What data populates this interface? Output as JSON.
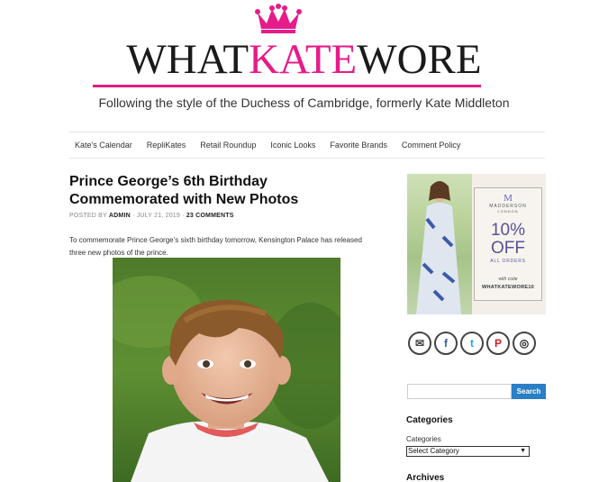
{
  "site": {
    "logo_part1": "WHAT",
    "logo_part2": "KATE",
    "logo_part3": "WORE",
    "tagline": "Following the style of the Duchess of Cambridge, formerly Kate Middleton",
    "accent_color": "#e51c8a"
  },
  "nav": {
    "items": [
      {
        "label": "Kate's Calendar"
      },
      {
        "label": "RepliKates"
      },
      {
        "label": "Retail Roundup"
      },
      {
        "label": "Iconic Looks"
      },
      {
        "label": "Favorite Brands"
      },
      {
        "label": "Comment Policy"
      }
    ]
  },
  "post": {
    "title": "Prince George’s 6th Birthday Commemorated with New Photos",
    "posted_by": "POSTED BY",
    "author": "ADMIN",
    "date": "JULY 21, 2019",
    "comments": "23 COMMENTS",
    "intro": "To commemorate Prince George’s sixth birthday tomorrow, Kensington Palace has released three new photos of the prince."
  },
  "sidebar": {
    "ad": {
      "logo_letter": "M",
      "brand": "MADDERSON",
      "brand_sub": "LONDON",
      "percent": "10%",
      "off": "OFF",
      "all_orders": "ALL ORDERS",
      "with_code": "with code",
      "code": "WHATKATEWORE10"
    },
    "social": [
      {
        "icon": "email-icon",
        "glyph": "✉"
      },
      {
        "icon": "facebook-icon",
        "glyph": "f"
      },
      {
        "icon": "twitter-icon",
        "glyph": "t"
      },
      {
        "icon": "pinterest-icon",
        "glyph": "P"
      },
      {
        "icon": "instagram-icon",
        "glyph": "◎"
      }
    ],
    "search": {
      "placeholder": "",
      "button_label": "Search"
    },
    "categories": {
      "title": "Categories",
      "label": "Categories",
      "selected": "Select Category"
    },
    "archives": {
      "title": "Archives"
    }
  }
}
